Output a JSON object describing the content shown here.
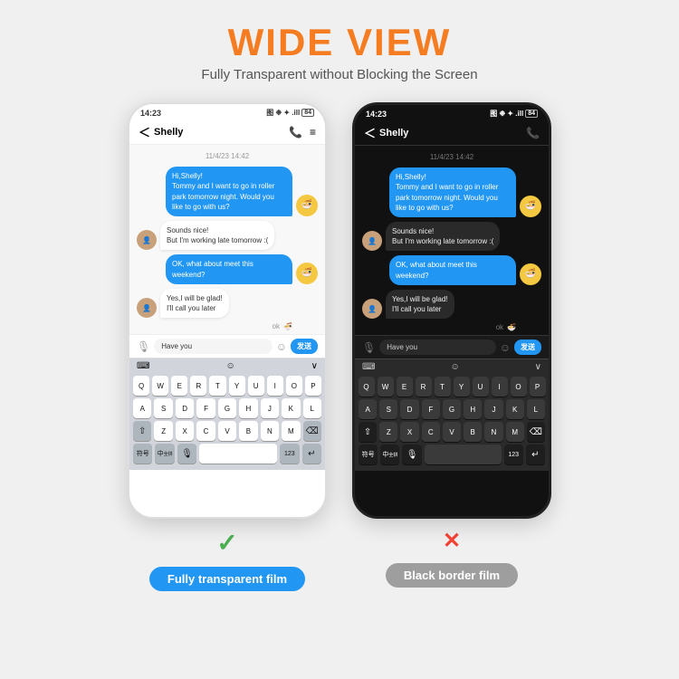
{
  "header": {
    "title": "WIDE VIEW",
    "subtitle": "Fully Transparent without Blocking the Screen"
  },
  "phone_left": {
    "status_time": "14:23",
    "status_icons": "图 8 令 .ill 84",
    "contact_name": "Shelly",
    "date_stamp": "11/4/23 14:42",
    "messages": [
      {
        "type": "sent",
        "text": "Hi,Shelly!\nTommy and I want to go in roller park tomorrow night. Would you like to go with us?"
      },
      {
        "type": "received",
        "text": "Sounds nice!\nBut I'm working late tomorrow :("
      },
      {
        "type": "sent",
        "text": "OK, what about meet this weekend?"
      },
      {
        "type": "received",
        "text": "Yes,I will be glad!\nI'll call you later"
      }
    ],
    "input_text": "Have you",
    "input_emoji": "☺",
    "send_label": "发送",
    "keyboard_rows": [
      [
        "Q",
        "W",
        "E",
        "R",
        "T",
        "Y",
        "U",
        "I",
        "O",
        "P"
      ],
      [
        "A",
        "S",
        "D",
        "F",
        "G",
        "H",
        "J",
        "K",
        "L"
      ],
      [
        "⇧",
        "Z",
        "X",
        "C",
        "V",
        "B",
        "N",
        "M",
        "⌫"
      ],
      [
        "符号",
        "中",
        "♪",
        "space",
        "123",
        "⏎"
      ]
    ]
  },
  "phone_right": {
    "status_time": "14:23",
    "status_icons": "图 8 令 .ill 84",
    "contact_name": "Shelly",
    "date_stamp": "11/4/23 14:42",
    "messages": [
      {
        "type": "sent",
        "text": "Hi,Shelly!\nTommy and I want to go in roller park tomorrow night. Would you like to go with us?"
      },
      {
        "type": "received",
        "text": "Sounds nice!\nBut I'm working late tomorrow :("
      },
      {
        "type": "sent",
        "text": "OK, what about meet this weekend?"
      },
      {
        "type": "received",
        "text": "Yes,I will be glad!\nI'll call you later"
      }
    ],
    "input_text": "Have you",
    "send_label": "发送"
  },
  "labels": {
    "left_check": "✓",
    "right_cross": "✕",
    "left_label": "Fully transparent film",
    "right_label": "Black border film"
  }
}
